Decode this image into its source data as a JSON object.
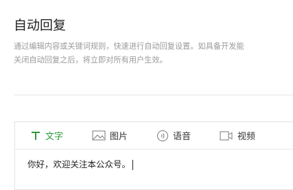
{
  "page": {
    "title": "自动回复",
    "description_line1": "通过编辑内容或关键词规则，快速进行自动回复设置。如具备开发能",
    "description_line2": "关闭自动回复之后，将立即对所有用户生效。"
  },
  "editor": {
    "tabs": [
      {
        "label": "文字",
        "icon": "text-icon",
        "active": true
      },
      {
        "label": "图片",
        "icon": "image-icon",
        "active": false
      },
      {
        "label": "语音",
        "icon": "voice-icon",
        "active": false
      },
      {
        "label": "视频",
        "icon": "video-icon",
        "active": false
      }
    ],
    "content": "你好，欢迎关注本公众号。"
  },
  "colors": {
    "accent": "#2b9a3a",
    "text": "#222222",
    "muted": "#9a9a9a",
    "border": "#e3e3e3"
  }
}
